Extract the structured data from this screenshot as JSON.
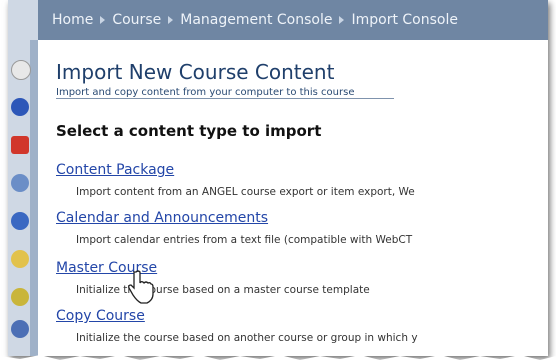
{
  "breadcrumb": [
    "Home",
    "Course",
    "Management Console",
    "Import Console"
  ],
  "page": {
    "title": "Import New Course Content",
    "subtitle": "Import and copy content from your computer to this course",
    "section_heading": "Select a content type to import"
  },
  "options": [
    {
      "label": "Content Package",
      "description": "Import content from an ANGEL course export or item export, We"
    },
    {
      "label": "Calendar and Announcements",
      "description": "Import calendar entries from a text file (compatible with WebCT"
    },
    {
      "label": "Master Course",
      "description": "Initialize the course based on a master course template"
    },
    {
      "label": "Copy Course",
      "description": "Initialize the course based on another course or group in which y"
    }
  ],
  "colors": {
    "breadcrumb_bg": "#6f86a3",
    "link": "#2346a8",
    "title": "#1f3f6b"
  }
}
